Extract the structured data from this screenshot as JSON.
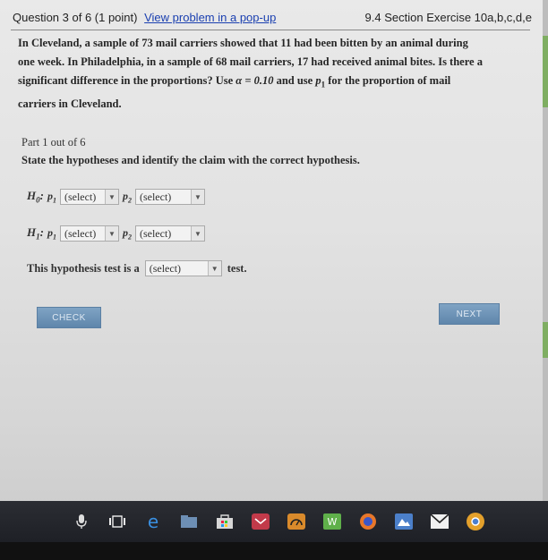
{
  "header": {
    "question_label": "Question 3 of 6 (1 point)",
    "popup_link": "View problem in a pop-up",
    "section": "9.4 Section Exercise 10a,b,c,d,e"
  },
  "problem": {
    "line1": "In Cleveland, a sample of 73 mail carriers showed that 11 had been bitten by an animal during",
    "line2": "one week. In Philadelphia, in a sample of 68 mail carriers, 17 had received animal bites. Is there a",
    "line3a": "significant difference in the proportions? Use ",
    "alpha": "α = 0.10",
    "line3b": " and use ",
    "p1": "p",
    "p1_sub": "1",
    "line3c": " for the proportion of mail",
    "line4": "carriers in Cleveland."
  },
  "part": {
    "label": "Part 1 out of 6",
    "instruction": "State the hypotheses and identify the claim with the correct hypothesis."
  },
  "h0": {
    "label": "H",
    "sub": "0",
    "p1": "p",
    "p1_sub": "1",
    "select1": "(select)",
    "p2": "p",
    "p2_sub": "2",
    "select2": "(select)"
  },
  "h1": {
    "label": "H",
    "sub": "1",
    "p1": "p",
    "p1_sub": "1",
    "select1": "(select)",
    "p2": "p",
    "p2_sub": "2",
    "select2": "(select)"
  },
  "testline": {
    "prefix": "This hypothesis test is a",
    "select": "(select)",
    "suffix": "test."
  },
  "buttons": {
    "check": "CHECK",
    "next": "NEXT"
  },
  "colors": {
    "link": "#1a3fb0",
    "button": "#6b90b6",
    "taskbar": "#24262c"
  },
  "taskbar": {
    "icons": [
      "microphone-icon",
      "task-view-icon",
      "edge-browser-icon",
      "file-explorer-icon",
      "store-icon",
      "mail-icon",
      "gauge-app-icon",
      "word-icon",
      "firefox-icon",
      "photos-icon",
      "mail-envelope-icon",
      "chrome-icon"
    ]
  }
}
